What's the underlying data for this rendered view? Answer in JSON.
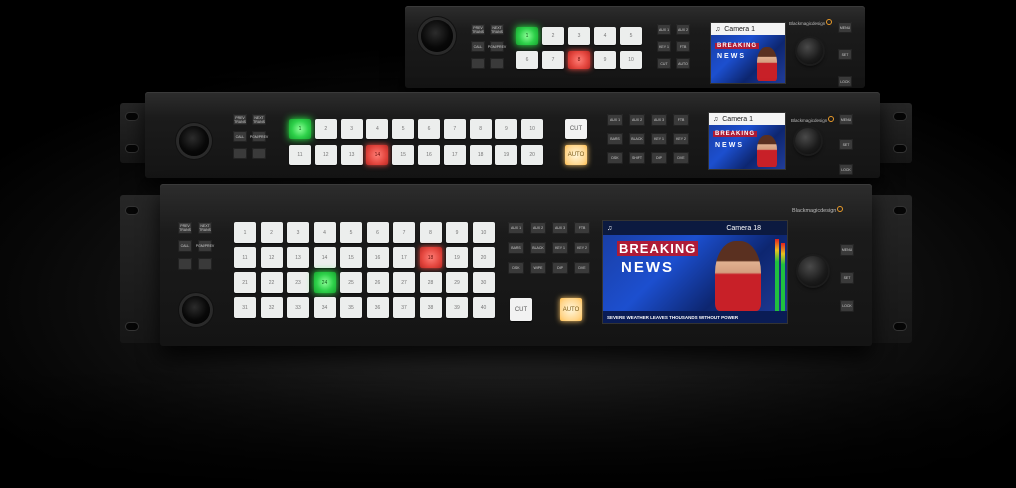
{
  "brand": "Blackmagicdesign",
  "panels": {
    "top": {
      "left_keys": [
        "PREV TRANS",
        "NEXT TRANS",
        "CALL",
        "PGM/PREV",
        "",
        ""
      ],
      "row1": [
        "1",
        "2",
        "3",
        "4",
        "5"
      ],
      "row2": [
        "6",
        "7",
        "8",
        "9",
        "10"
      ],
      "active_green": "1",
      "active_red": "8",
      "function_keys": [
        "AUX 1",
        "AUX 2",
        "KEY 1",
        "FTB",
        "CUT",
        "AUTO"
      ],
      "side_keys": [
        "MENU",
        "SET",
        "LOCK"
      ],
      "lcd": {
        "title": "Camera 1",
        "headline_1": "BREAKING",
        "headline_2": "NEWS"
      }
    },
    "middle": {
      "left_keys": [
        "PREV TRANS",
        "NEXT TRANS",
        "CALL",
        "PGM/PREV",
        "",
        ""
      ],
      "row1": [
        "1",
        "2",
        "3",
        "4",
        "5",
        "6",
        "7",
        "8",
        "9",
        "10"
      ],
      "row2": [
        "11",
        "12",
        "13",
        "14",
        "15",
        "16",
        "17",
        "18",
        "19",
        "20"
      ],
      "active_green": "1",
      "active_red": "14",
      "cut_label": "CUT",
      "auto_label": "AUTO",
      "function_keys": [
        "AUX 1",
        "AUX 2",
        "AUX 3",
        "FTB",
        "BARS",
        "BLACK",
        "KEY 1",
        "KEY 2",
        "DSK",
        "SHIFT",
        "DIP",
        "DVE"
      ],
      "side_keys": [
        "MENU",
        "SET",
        "LOCK"
      ],
      "lcd": {
        "title": "Camera 1",
        "headline_1": "BREAKING",
        "headline_2": "NEWS"
      }
    },
    "bottom": {
      "left_keys": [
        "PREV TRANS",
        "NEXT TRANS",
        "CALL",
        "PGM/PREV",
        "",
        ""
      ],
      "rows": [
        [
          "1",
          "2",
          "3",
          "4",
          "5",
          "6",
          "7",
          "8",
          "9",
          "10"
        ],
        [
          "11",
          "12",
          "13",
          "14",
          "15",
          "16",
          "17",
          "18",
          "19",
          "20"
        ],
        [
          "21",
          "22",
          "23",
          "24",
          "25",
          "26",
          "27",
          "28",
          "29",
          "30"
        ],
        [
          "31",
          "32",
          "33",
          "34",
          "35",
          "36",
          "37",
          "38",
          "39",
          "40"
        ]
      ],
      "active_green": "24",
      "active_red": "18",
      "cut_label": "CUT",
      "auto_label": "AUTO",
      "function_keys": [
        "AUX 1",
        "AUX 2",
        "AUX 3",
        "FTB",
        "BARS",
        "BLACK",
        "KEY 1",
        "KEY 2",
        "DSK",
        "WIPE",
        "DIP",
        "DVE"
      ],
      "side_keys": [
        "MENU",
        "SET",
        "LOCK"
      ],
      "lcd": {
        "title": "Camera 18",
        "headline_1": "BREAKING",
        "headline_2": "NEWS",
        "ticker": "SEVERE WEATHER LEAVES THOUSANDS WITHOUT POWER"
      }
    }
  }
}
